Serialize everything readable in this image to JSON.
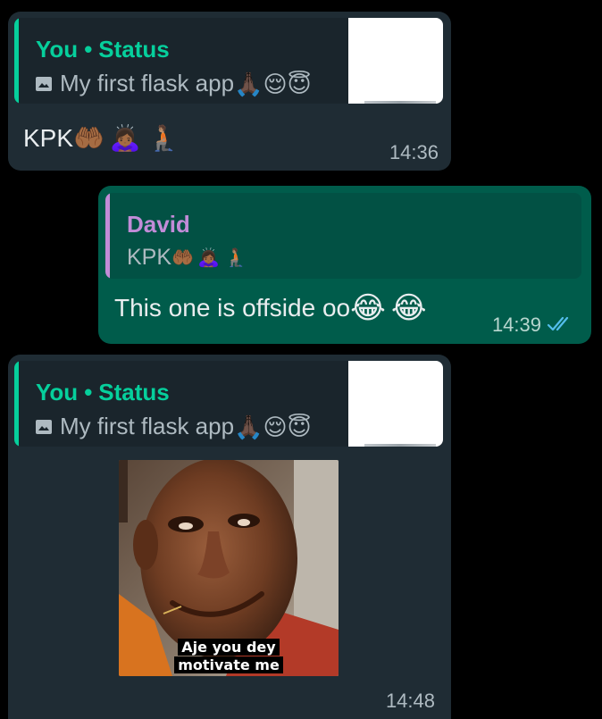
{
  "messages": [
    {
      "direction": "incoming",
      "quote": {
        "author": "You",
        "separator": "•",
        "source": "Status",
        "media_icon": "image-icon",
        "text": "My first flask app",
        "emojis": [
          "🙏🏿",
          "😌",
          "😇"
        ],
        "has_thumbnail": true
      },
      "text": "KPK",
      "emojis": [
        "🤲🏾",
        "🙇🏾‍♀️",
        "🧎🏽"
      ],
      "time": "14:36"
    },
    {
      "direction": "outgoing",
      "quote": {
        "author": "David",
        "text": "KPK",
        "emojis": [
          "🤲🏾",
          "🙇🏾‍♀️",
          "🧎🏽"
        ]
      },
      "text": "This one is offside oo",
      "emojis": [
        "😂",
        "😂"
      ],
      "time": "14:39",
      "status_icon": "double-check-read-icon"
    },
    {
      "direction": "incoming",
      "quote": {
        "author": "You",
        "separator": "•",
        "source": "Status",
        "media_icon": "image-icon",
        "text": "My first flask app",
        "emojis": [
          "🙏🏿",
          "😌",
          "😇"
        ],
        "has_thumbnail": true
      },
      "sticker": {
        "caption_line1": "Aje you dey",
        "caption_line2": "motivate me"
      },
      "time": "14:48"
    }
  ],
  "colors": {
    "background": "#000000",
    "incoming_bubble": "#1f2c34",
    "outgoing_bubble": "#005c4b",
    "status_author": "#06cf9c",
    "david_author": "#c28cd8",
    "read_ticks": "#53bdeb"
  }
}
